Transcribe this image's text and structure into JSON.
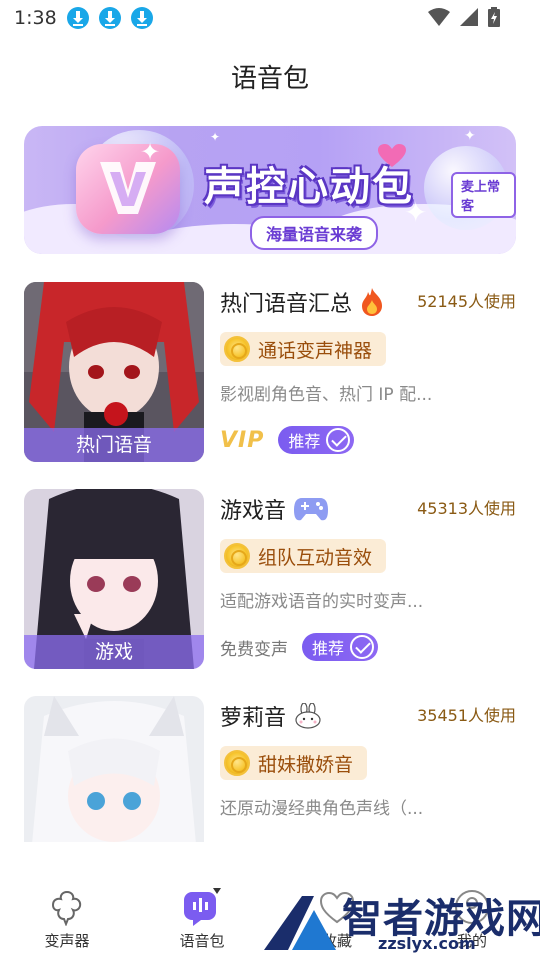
{
  "status_bar": {
    "time": "1:38"
  },
  "page": {
    "title": "语音包"
  },
  "banner": {
    "title": "声控心动包",
    "tag": "麦上常客",
    "subtitle": "海量语音来袭"
  },
  "voice_packs": [
    {
      "title": "热门语音汇总",
      "title_icon": "fire-icon",
      "usage": "52145人使用",
      "feature": "通话变声神器",
      "description": "影视剧角色音、热门 IP 配...",
      "thumb_label": "热门语音",
      "tier_label": "VIP",
      "tier_type": "vip",
      "badge": "推荐"
    },
    {
      "title": "游戏音",
      "title_icon": "gamepad-icon",
      "usage": "45313人使用",
      "feature": "组队互动音效",
      "description": "适配游戏语音的实时变声...",
      "thumb_label": "游戏",
      "tier_label": "免费变声",
      "tier_type": "free",
      "badge": "推荐"
    },
    {
      "title": "萝莉音",
      "title_icon": "bunny-icon",
      "usage": "35451人使用",
      "feature": "甜妹撒娇音",
      "description": "还原动漫经典角色声线（...",
      "thumb_label": "",
      "tier_label": "",
      "tier_type": "",
      "badge": ""
    }
  ],
  "bottom_nav": [
    {
      "label": "变声器",
      "icon": "voice-changer-icon",
      "active": false
    },
    {
      "label": "语音包",
      "icon": "voice-pack-icon",
      "active": true
    },
    {
      "label": "收藏",
      "icon": "heart-icon",
      "active": false
    },
    {
      "label": "我的",
      "icon": "profile-icon",
      "active": false
    }
  ],
  "watermark": {
    "text": "智者游戏网",
    "url": "zzslyx.com"
  },
  "colors": {
    "accent": "#7b5cf0",
    "usage_text": "#8a5a14",
    "feature_bg": "#fbecd6",
    "feature_text": "#9a4e0c",
    "download_icon": "#19a7e8"
  }
}
